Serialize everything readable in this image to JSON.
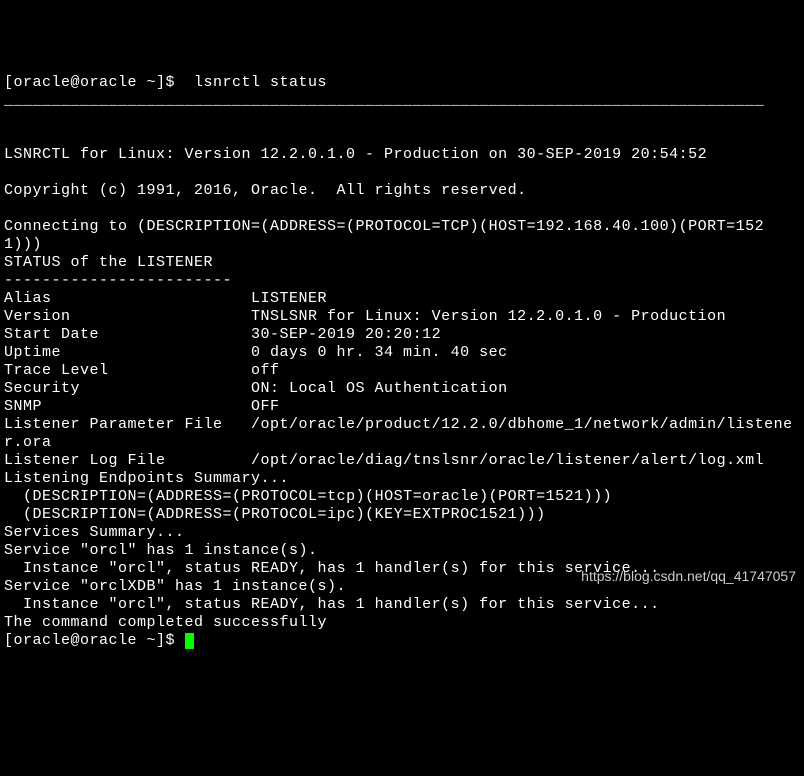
{
  "prompt1": "[oracle@oracle ~]$  lsnrctl status",
  "hr": "________________________________________________________________________________",
  "blank": "",
  "header": "LSNRCTL for Linux: Version 12.2.0.1.0 - Production on 30-SEP-2019 20:54:52",
  "copyright": "Copyright (c) 1991, 2016, Oracle.  All rights reserved.",
  "connecting": "Connecting to (DESCRIPTION=(ADDRESS=(PROTOCOL=TCP)(HOST=192.168.40.100)(PORT=1521)))",
  "status_title": "STATUS of the LISTENER",
  "dashes": "------------------------",
  "alias": "Alias                     LISTENER",
  "version": "Version                   TNSLSNR for Linux: Version 12.2.0.1.0 - Production",
  "startdate": "Start Date                30-SEP-2019 20:20:12",
  "uptime": "Uptime                    0 days 0 hr. 34 min. 40 sec",
  "trace": "Trace Level               off",
  "security": "Security                  ON: Local OS Authentication",
  "snmp": "SNMP                      OFF",
  "paramfile": "Listener Parameter File   /opt/oracle/product/12.2.0/dbhome_1/network/admin/listener.ora",
  "logfile": "Listener Log File         /opt/oracle/diag/tnslsnr/oracle/listener/alert/log.xml",
  "endpoints_title": "Listening Endpoints Summary...",
  "endpoint1": "  (DESCRIPTION=(ADDRESS=(PROTOCOL=tcp)(HOST=oracle)(PORT=1521)))",
  "endpoint2": "  (DESCRIPTION=(ADDRESS=(PROTOCOL=ipc)(KEY=EXTPROC1521)))",
  "services_title": "Services Summary...",
  "svc1": "Service \"orcl\" has 1 instance(s).",
  "svc1_inst": "  Instance \"orcl\", status READY, has 1 handler(s) for this service...",
  "svc2": "Service \"orclXDB\" has 1 instance(s).",
  "svc2_inst": "  Instance \"orcl\", status READY, has 1 handler(s) for this service...",
  "completed": "The command completed successfully",
  "prompt2": "[oracle@oracle ~]$ ",
  "watermark": "https://blog.csdn.net/qq_41747057"
}
